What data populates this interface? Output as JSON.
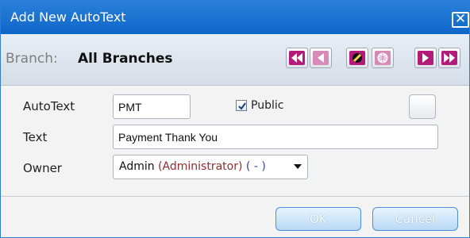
{
  "window": {
    "title": "Add New AutoText",
    "close_icon": "✕"
  },
  "branch": {
    "label": "Branch:",
    "value": "All Branches"
  },
  "toolbar": {
    "buttons": [
      {
        "name": "first-record-icon"
      },
      {
        "name": "previous-record-icon"
      },
      {
        "name": "edit-icon"
      },
      {
        "name": "globe-icon"
      },
      {
        "name": "next-record-icon"
      },
      {
        "name": "last-record-icon"
      }
    ]
  },
  "form": {
    "autotext_label": "AutoText",
    "autotext_value": "PMT",
    "public_label": "Public",
    "text_label": "Text",
    "text_value": "Payment Thank You",
    "owner_label": "Owner",
    "owner_name": "Admin",
    "owner_role": "(Administrator)",
    "owner_dash": "( - )"
  },
  "actions": {
    "ok_label": "OK",
    "cancel_label": "Cancel"
  },
  "colors": {
    "titlebar": "#0e66c9",
    "nav_button": "#b31b78",
    "owner_role": "#8b2f2f",
    "owner_dash": "#3344aa"
  }
}
